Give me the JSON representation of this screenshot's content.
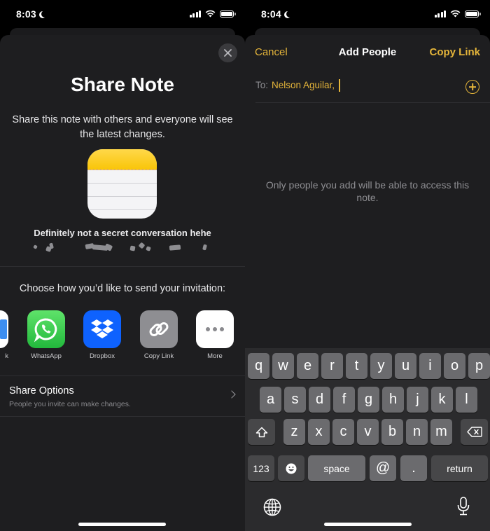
{
  "left_screen": {
    "status_bar": {
      "time": "8:03",
      "moon_icon": "moon-icon",
      "signal_icon": "cellular-signal-icon",
      "wifi_icon": "wifi-icon",
      "battery_icon": "battery-full-icon"
    },
    "close_button": {
      "icon": "close-icon"
    },
    "title": "Share Note",
    "description": "Share this note with others and everyone will see the latest changes.",
    "note_icon": "notes-app-icon",
    "note_name": "Definitely not a secret conversation hehe",
    "choose_prompt": "Choose how you’d like to send your invitation:",
    "apps": [
      {
        "label": "k",
        "icon": "partial-app-icon",
        "color": "#ffffff"
      },
      {
        "label": "WhatsApp",
        "icon": "whatsapp-icon",
        "color": "#2fc14d"
      },
      {
        "label": "Dropbox",
        "icon": "dropbox-icon",
        "color": "#0e62fe"
      },
      {
        "label": "Copy Link",
        "icon": "link-icon",
        "color": "#8e8e92"
      },
      {
        "label": "More",
        "icon": "more-dots-icon",
        "color": "#ffffff"
      }
    ],
    "share_options": {
      "title": "Share Options",
      "subtitle": "People you invite can make changes.",
      "icon": "chevron-right-icon"
    }
  },
  "right_screen": {
    "status_bar": {
      "time": "8:04",
      "moon_icon": "moon-icon",
      "signal_icon": "cellular-signal-icon",
      "wifi_icon": "wifi-icon",
      "battery_icon": "battery-full-icon"
    },
    "nav": {
      "cancel": "Cancel",
      "title": "Add People",
      "copy_link": "Copy Link"
    },
    "to_field": {
      "label": "To:",
      "value": "Nelson Aguilar,",
      "add_icon": "add-circle-icon"
    },
    "access_message": "Only people you add will be able to access this note.",
    "keyboard": {
      "row1": [
        "q",
        "w",
        "e",
        "r",
        "t",
        "y",
        "u",
        "i",
        "o",
        "p"
      ],
      "row2": [
        "a",
        "s",
        "d",
        "f",
        "g",
        "h",
        "j",
        "k",
        "l"
      ],
      "row3": [
        "z",
        "x",
        "c",
        "v",
        "b",
        "n",
        "m"
      ],
      "shift_icon": "shift-icon",
      "delete_icon": "backspace-icon",
      "numbers": "123",
      "emoji_icon": "emoji-icon",
      "space": "space",
      "at": "@",
      "period": ".",
      "return": "return",
      "globe_icon": "globe-icon",
      "mic_icon": "microphone-icon"
    }
  },
  "colors": {
    "accent": "#e5b53a",
    "sheet_bg": "#1e1e20",
    "keyboard_bg": "#2b2b2d",
    "key_bg": "#6b6b6e",
    "key_dark_bg": "#474749"
  }
}
